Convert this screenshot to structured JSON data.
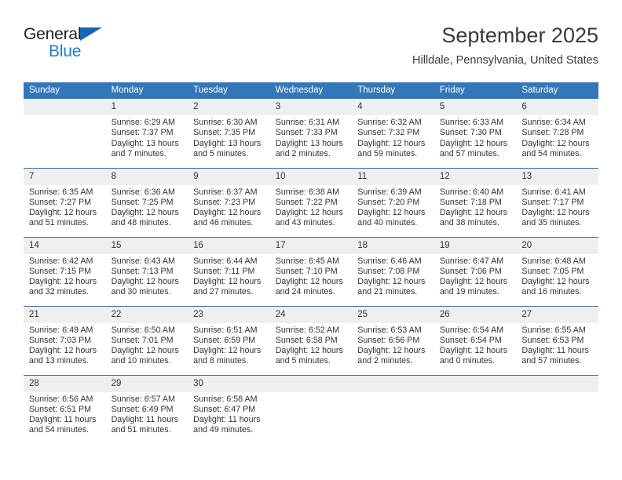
{
  "brand": {
    "name_part1": "General",
    "name_part2": "Blue",
    "triangle_color": "#1667b1",
    "blue_color": "#1b7fd4"
  },
  "header": {
    "title": "September 2025",
    "subtitle": "Hilldale, Pennsylvania, United States",
    "header_bg_color": "#3277b8",
    "week_divider_color": "#2e6da4",
    "daynum_bg_color": "#efefef"
  },
  "weekday_headers": [
    "Sunday",
    "Monday",
    "Tuesday",
    "Wednesday",
    "Thursday",
    "Friday",
    "Saturday"
  ],
  "weeks": [
    [
      {
        "day": "",
        "blank": true
      },
      {
        "day": "1",
        "sunrise": "Sunrise: 6:29 AM",
        "sunset": "Sunset: 7:37 PM",
        "daylight1": "Daylight: 13 hours",
        "daylight2": "and 7 minutes."
      },
      {
        "day": "2",
        "sunrise": "Sunrise: 6:30 AM",
        "sunset": "Sunset: 7:35 PM",
        "daylight1": "Daylight: 13 hours",
        "daylight2": "and 5 minutes."
      },
      {
        "day": "3",
        "sunrise": "Sunrise: 6:31 AM",
        "sunset": "Sunset: 7:33 PM",
        "daylight1": "Daylight: 13 hours",
        "daylight2": "and 2 minutes."
      },
      {
        "day": "4",
        "sunrise": "Sunrise: 6:32 AM",
        "sunset": "Sunset: 7:32 PM",
        "daylight1": "Daylight: 12 hours",
        "daylight2": "and 59 minutes."
      },
      {
        "day": "5",
        "sunrise": "Sunrise: 6:33 AM",
        "sunset": "Sunset: 7:30 PM",
        "daylight1": "Daylight: 12 hours",
        "daylight2": "and 57 minutes."
      },
      {
        "day": "6",
        "sunrise": "Sunrise: 6:34 AM",
        "sunset": "Sunset: 7:28 PM",
        "daylight1": "Daylight: 12 hours",
        "daylight2": "and 54 minutes."
      }
    ],
    [
      {
        "day": "7",
        "sunrise": "Sunrise: 6:35 AM",
        "sunset": "Sunset: 7:27 PM",
        "daylight1": "Daylight: 12 hours",
        "daylight2": "and 51 minutes."
      },
      {
        "day": "8",
        "sunrise": "Sunrise: 6:36 AM",
        "sunset": "Sunset: 7:25 PM",
        "daylight1": "Daylight: 12 hours",
        "daylight2": "and 48 minutes."
      },
      {
        "day": "9",
        "sunrise": "Sunrise: 6:37 AM",
        "sunset": "Sunset: 7:23 PM",
        "daylight1": "Daylight: 12 hours",
        "daylight2": "and 46 minutes."
      },
      {
        "day": "10",
        "sunrise": "Sunrise: 6:38 AM",
        "sunset": "Sunset: 7:22 PM",
        "daylight1": "Daylight: 12 hours",
        "daylight2": "and 43 minutes."
      },
      {
        "day": "11",
        "sunrise": "Sunrise: 6:39 AM",
        "sunset": "Sunset: 7:20 PM",
        "daylight1": "Daylight: 12 hours",
        "daylight2": "and 40 minutes."
      },
      {
        "day": "12",
        "sunrise": "Sunrise: 6:40 AM",
        "sunset": "Sunset: 7:18 PM",
        "daylight1": "Daylight: 12 hours",
        "daylight2": "and 38 minutes."
      },
      {
        "day": "13",
        "sunrise": "Sunrise: 6:41 AM",
        "sunset": "Sunset: 7:17 PM",
        "daylight1": "Daylight: 12 hours",
        "daylight2": "and 35 minutes."
      }
    ],
    [
      {
        "day": "14",
        "sunrise": "Sunrise: 6:42 AM",
        "sunset": "Sunset: 7:15 PM",
        "daylight1": "Daylight: 12 hours",
        "daylight2": "and 32 minutes."
      },
      {
        "day": "15",
        "sunrise": "Sunrise: 6:43 AM",
        "sunset": "Sunset: 7:13 PM",
        "daylight1": "Daylight: 12 hours",
        "daylight2": "and 30 minutes."
      },
      {
        "day": "16",
        "sunrise": "Sunrise: 6:44 AM",
        "sunset": "Sunset: 7:11 PM",
        "daylight1": "Daylight: 12 hours",
        "daylight2": "and 27 minutes."
      },
      {
        "day": "17",
        "sunrise": "Sunrise: 6:45 AM",
        "sunset": "Sunset: 7:10 PM",
        "daylight1": "Daylight: 12 hours",
        "daylight2": "and 24 minutes."
      },
      {
        "day": "18",
        "sunrise": "Sunrise: 6:46 AM",
        "sunset": "Sunset: 7:08 PM",
        "daylight1": "Daylight: 12 hours",
        "daylight2": "and 21 minutes."
      },
      {
        "day": "19",
        "sunrise": "Sunrise: 6:47 AM",
        "sunset": "Sunset: 7:06 PM",
        "daylight1": "Daylight: 12 hours",
        "daylight2": "and 19 minutes."
      },
      {
        "day": "20",
        "sunrise": "Sunrise: 6:48 AM",
        "sunset": "Sunset: 7:05 PM",
        "daylight1": "Daylight: 12 hours",
        "daylight2": "and 16 minutes."
      }
    ],
    [
      {
        "day": "21",
        "sunrise": "Sunrise: 6:49 AM",
        "sunset": "Sunset: 7:03 PM",
        "daylight1": "Daylight: 12 hours",
        "daylight2": "and 13 minutes."
      },
      {
        "day": "22",
        "sunrise": "Sunrise: 6:50 AM",
        "sunset": "Sunset: 7:01 PM",
        "daylight1": "Daylight: 12 hours",
        "daylight2": "and 10 minutes."
      },
      {
        "day": "23",
        "sunrise": "Sunrise: 6:51 AM",
        "sunset": "Sunset: 6:59 PM",
        "daylight1": "Daylight: 12 hours",
        "daylight2": "and 8 minutes."
      },
      {
        "day": "24",
        "sunrise": "Sunrise: 6:52 AM",
        "sunset": "Sunset: 6:58 PM",
        "daylight1": "Daylight: 12 hours",
        "daylight2": "and 5 minutes."
      },
      {
        "day": "25",
        "sunrise": "Sunrise: 6:53 AM",
        "sunset": "Sunset: 6:56 PM",
        "daylight1": "Daylight: 12 hours",
        "daylight2": "and 2 minutes."
      },
      {
        "day": "26",
        "sunrise": "Sunrise: 6:54 AM",
        "sunset": "Sunset: 6:54 PM",
        "daylight1": "Daylight: 12 hours",
        "daylight2": "and 0 minutes."
      },
      {
        "day": "27",
        "sunrise": "Sunrise: 6:55 AM",
        "sunset": "Sunset: 6:53 PM",
        "daylight1": "Daylight: 11 hours",
        "daylight2": "and 57 minutes."
      }
    ],
    [
      {
        "day": "28",
        "sunrise": "Sunrise: 6:56 AM",
        "sunset": "Sunset: 6:51 PM",
        "daylight1": "Daylight: 11 hours",
        "daylight2": "and 54 minutes."
      },
      {
        "day": "29",
        "sunrise": "Sunrise: 6:57 AM",
        "sunset": "Sunset: 6:49 PM",
        "daylight1": "Daylight: 11 hours",
        "daylight2": "and 51 minutes."
      },
      {
        "day": "30",
        "sunrise": "Sunrise: 6:58 AM",
        "sunset": "Sunset: 6:47 PM",
        "daylight1": "Daylight: 11 hours",
        "daylight2": "and 49 minutes."
      },
      {
        "day": "",
        "blank": true
      },
      {
        "day": "",
        "blank": true
      },
      {
        "day": "",
        "blank": true
      },
      {
        "day": "",
        "blank": true
      }
    ]
  ]
}
